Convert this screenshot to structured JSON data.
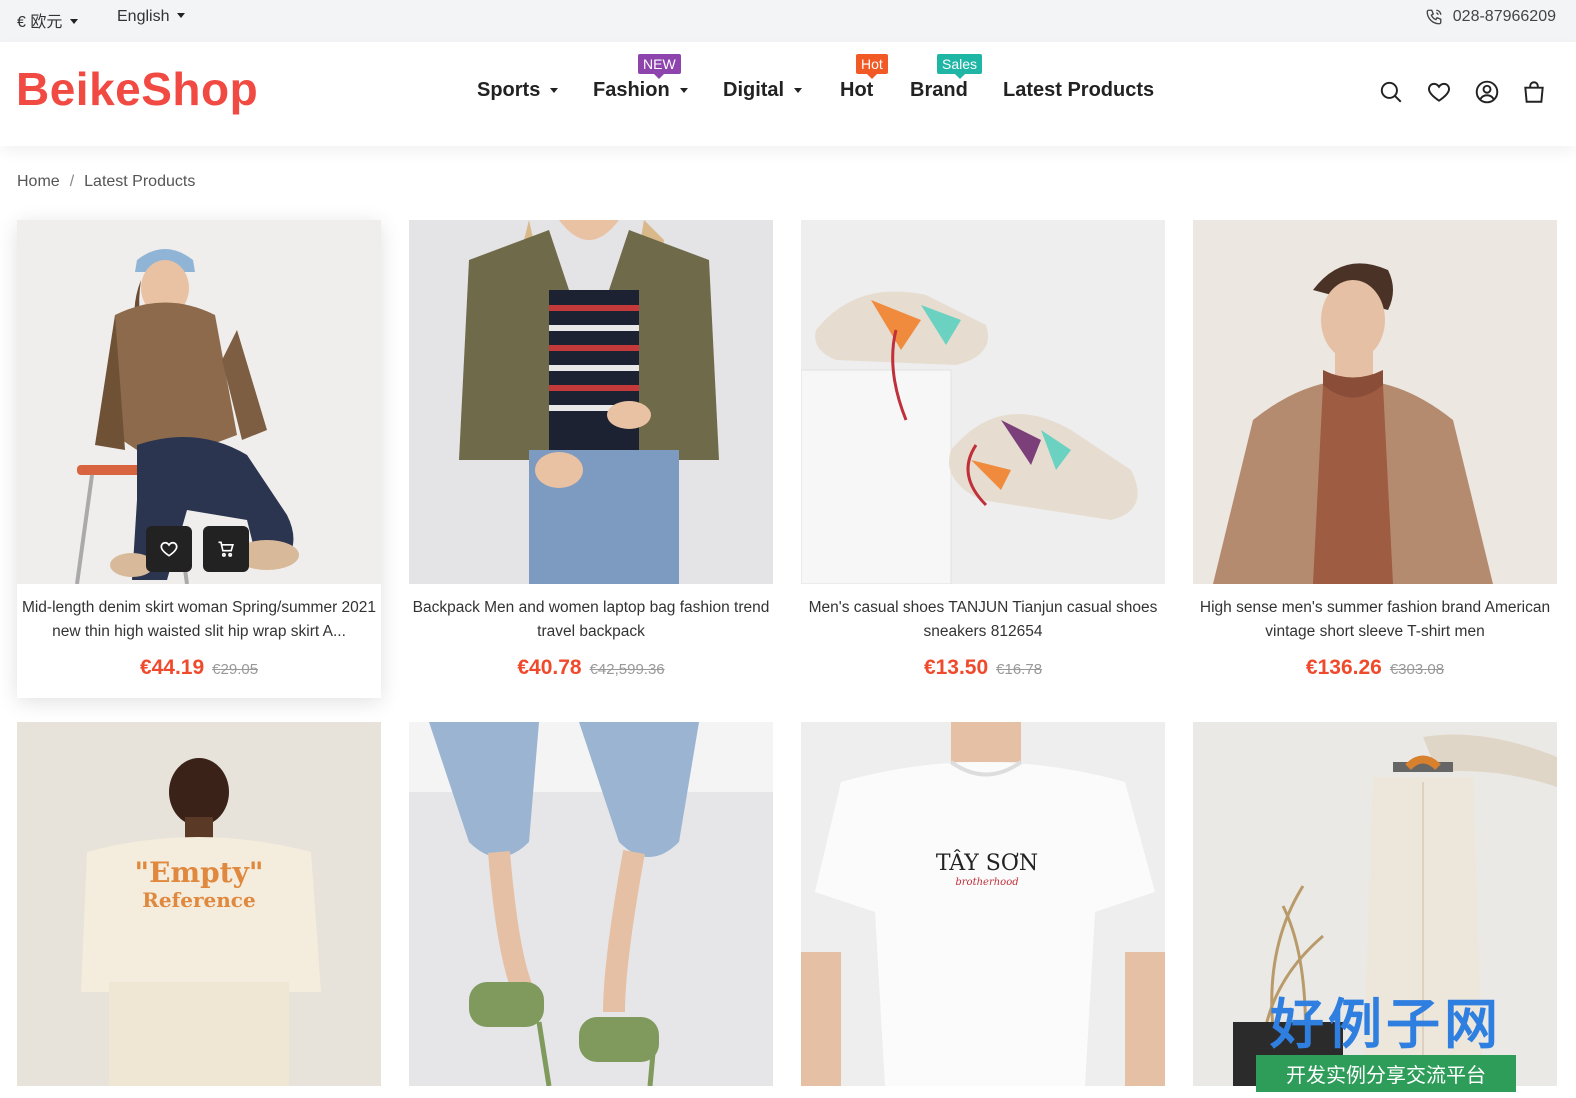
{
  "topbar": {
    "currency": "€ 欧元",
    "language": "English",
    "phone": "028-87966209"
  },
  "header": {
    "logo": "BeikeShop",
    "nav": [
      {
        "label": "Sports",
        "has_dropdown": true
      },
      {
        "label": "Fashion",
        "has_dropdown": true,
        "badge": "NEW",
        "badge_color": "#8e44ad"
      },
      {
        "label": "Digital",
        "has_dropdown": true
      },
      {
        "label": "Hot",
        "has_dropdown": false,
        "badge": "Hot",
        "badge_color": "#f15a24"
      },
      {
        "label": "Brand",
        "has_dropdown": false,
        "badge": "Sales",
        "badge_color": "#1fb6a6"
      },
      {
        "label": "Latest Products",
        "has_dropdown": false
      }
    ],
    "icons": [
      "search-icon",
      "heart-icon",
      "account-icon",
      "cart-icon"
    ]
  },
  "breadcrumb": {
    "home": "Home",
    "separator": "/",
    "current": "Latest Products"
  },
  "products": [
    {
      "title": "Mid-length denim skirt woman Spring/summer 2021 new thin high waisted slit hip wrap skirt A...",
      "price": "€44.19",
      "old_price": "€29.05"
    },
    {
      "title": "Backpack Men and women laptop bag fashion trend travel backpack",
      "price": "€40.78",
      "old_price": "€42,599.36"
    },
    {
      "title": "Men's casual shoes TANJUN Tianjun casual shoes sneakers 812654",
      "price": "€13.50",
      "old_price": "€16.78"
    },
    {
      "title": "High sense men's summer fashion brand American vintage short sleeve T-shirt men",
      "price": "€136.26",
      "old_price": "€303.08"
    }
  ],
  "product_images_row2": [
    {
      "print_line1": "\"Empty\"",
      "print_line2": "Reference"
    },
    {},
    {
      "print_line1": "TÂY SƠN",
      "print_line2": "brotherhood"
    },
    {}
  ],
  "watermark": {
    "title": "好例子网",
    "subtitle": "开发实例分享交流平台"
  },
  "colors": {
    "brand": "#f04a43",
    "price": "#f04a2d",
    "badge_new": "#8e44ad",
    "badge_hot": "#f15a24",
    "badge_sales": "#1fb6a6"
  }
}
